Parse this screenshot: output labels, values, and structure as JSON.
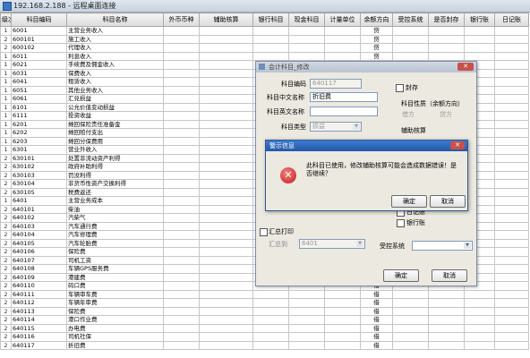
{
  "window": {
    "title": "192.168.2.188 - 远程桌面连接"
  },
  "table": {
    "headers": [
      "级次",
      "科目编码",
      "科目名称",
      "外币币种",
      "辅助核算",
      "银行科目",
      "现金科目",
      "计量单位",
      "余额方向",
      "受控系统",
      "是否封存",
      "银行账",
      "日记账"
    ],
    "rows": [
      [
        "1",
        "6001",
        "主营业务收入",
        "贷"
      ],
      [
        "2",
        "600101",
        "施工收入",
        "贷"
      ],
      [
        "2",
        "600102",
        "代理收入",
        "贷"
      ],
      [
        "1",
        "6011",
        "利息收入",
        "贷"
      ],
      [
        "1",
        "6021",
        "手续费及佣金收入",
        "贷"
      ],
      [
        "1",
        "6031",
        "保费收入",
        "贷"
      ],
      [
        "1",
        "6041",
        "租赁收入",
        "贷"
      ],
      [
        "1",
        "6051",
        "其他业务收入",
        "贷"
      ],
      [
        "1",
        "6061",
        "汇兑损益",
        "贷"
      ],
      [
        "1",
        "6101",
        "公允价值变动损益",
        "贷"
      ],
      [
        "1",
        "6111",
        "投资收益",
        "贷"
      ],
      [
        "1",
        "6201",
        "摊回保险责任准备金",
        "贷"
      ],
      [
        "1",
        "6202",
        "摊回赔付支出",
        "贷"
      ],
      [
        "1",
        "6203",
        "摊回分保费用",
        "贷"
      ],
      [
        "1",
        "6301",
        "营业外收入",
        "贷"
      ],
      [
        "2",
        "630101",
        "处置非流动资产利得",
        "贷"
      ],
      [
        "2",
        "630102",
        "政府补助利得",
        "贷"
      ],
      [
        "2",
        "630103",
        "罚没利得",
        "贷"
      ],
      [
        "2",
        "630104",
        "非货币性资产交换利得",
        "贷"
      ],
      [
        "2",
        "630105",
        "税费返还",
        "贷"
      ],
      [
        "1",
        "6401",
        "主营业务成本",
        "借"
      ],
      [
        "2",
        "640101",
        "柴油",
        "借"
      ],
      [
        "2",
        "640102",
        "汽柴气",
        "借"
      ],
      [
        "2",
        "640103",
        "汽车通行费",
        "借"
      ],
      [
        "2",
        "640104",
        "汽车修理费",
        "借"
      ],
      [
        "2",
        "640105",
        "汽车轮胎费",
        "借"
      ],
      [
        "2",
        "640106",
        "保险费",
        "借"
      ],
      [
        "2",
        "640107",
        "司机工资",
        "借"
      ],
      [
        "2",
        "640108",
        "车辆GPS服务费",
        "借"
      ],
      [
        "2",
        "640109",
        "港建费",
        "借"
      ],
      [
        "2",
        "640110",
        "码口费",
        "借"
      ],
      [
        "2",
        "640111",
        "车辆审车费",
        "借"
      ],
      [
        "2",
        "640112",
        "车辆年审费",
        "借"
      ],
      [
        "2",
        "640113",
        "保险费",
        "借"
      ],
      [
        "2",
        "640114",
        "港口作业费",
        "借"
      ],
      [
        "2",
        "640115",
        "办电费",
        "借"
      ],
      [
        "2",
        "640116",
        "司机社保",
        "借"
      ],
      [
        "2",
        "640117",
        "折旧费",
        "借"
      ]
    ]
  },
  "account_dialog": {
    "title": "会计科目_修改",
    "code_label": "科目编码",
    "code_value": "640117",
    "name_cn_label": "科目中文名称",
    "name_cn_value": "折旧费",
    "name_en_label": "科目英文名称",
    "name_en_value": "",
    "type_label": "科目类型",
    "type_value": "损益",
    "sealed_label": "封存",
    "nature_group_label": "科目性质（余额方向）",
    "nature_debit": "借方",
    "nature_credit": "贷方",
    "aux_label": "辅助核算",
    "summary_print_label": "汇总打印",
    "summary_to_label": "汇总到",
    "summary_to_value": "6401",
    "journal_label": "日记账",
    "bank_label": "银行账",
    "controlled_label": "受控系统",
    "ok": "确定",
    "cancel": "取消"
  },
  "alert": {
    "title": "警示信息",
    "message": "此科目已使用，修改辅助核算可能会造成数据错误！是否继续？",
    "ok": "确定",
    "cancel": "取消"
  }
}
